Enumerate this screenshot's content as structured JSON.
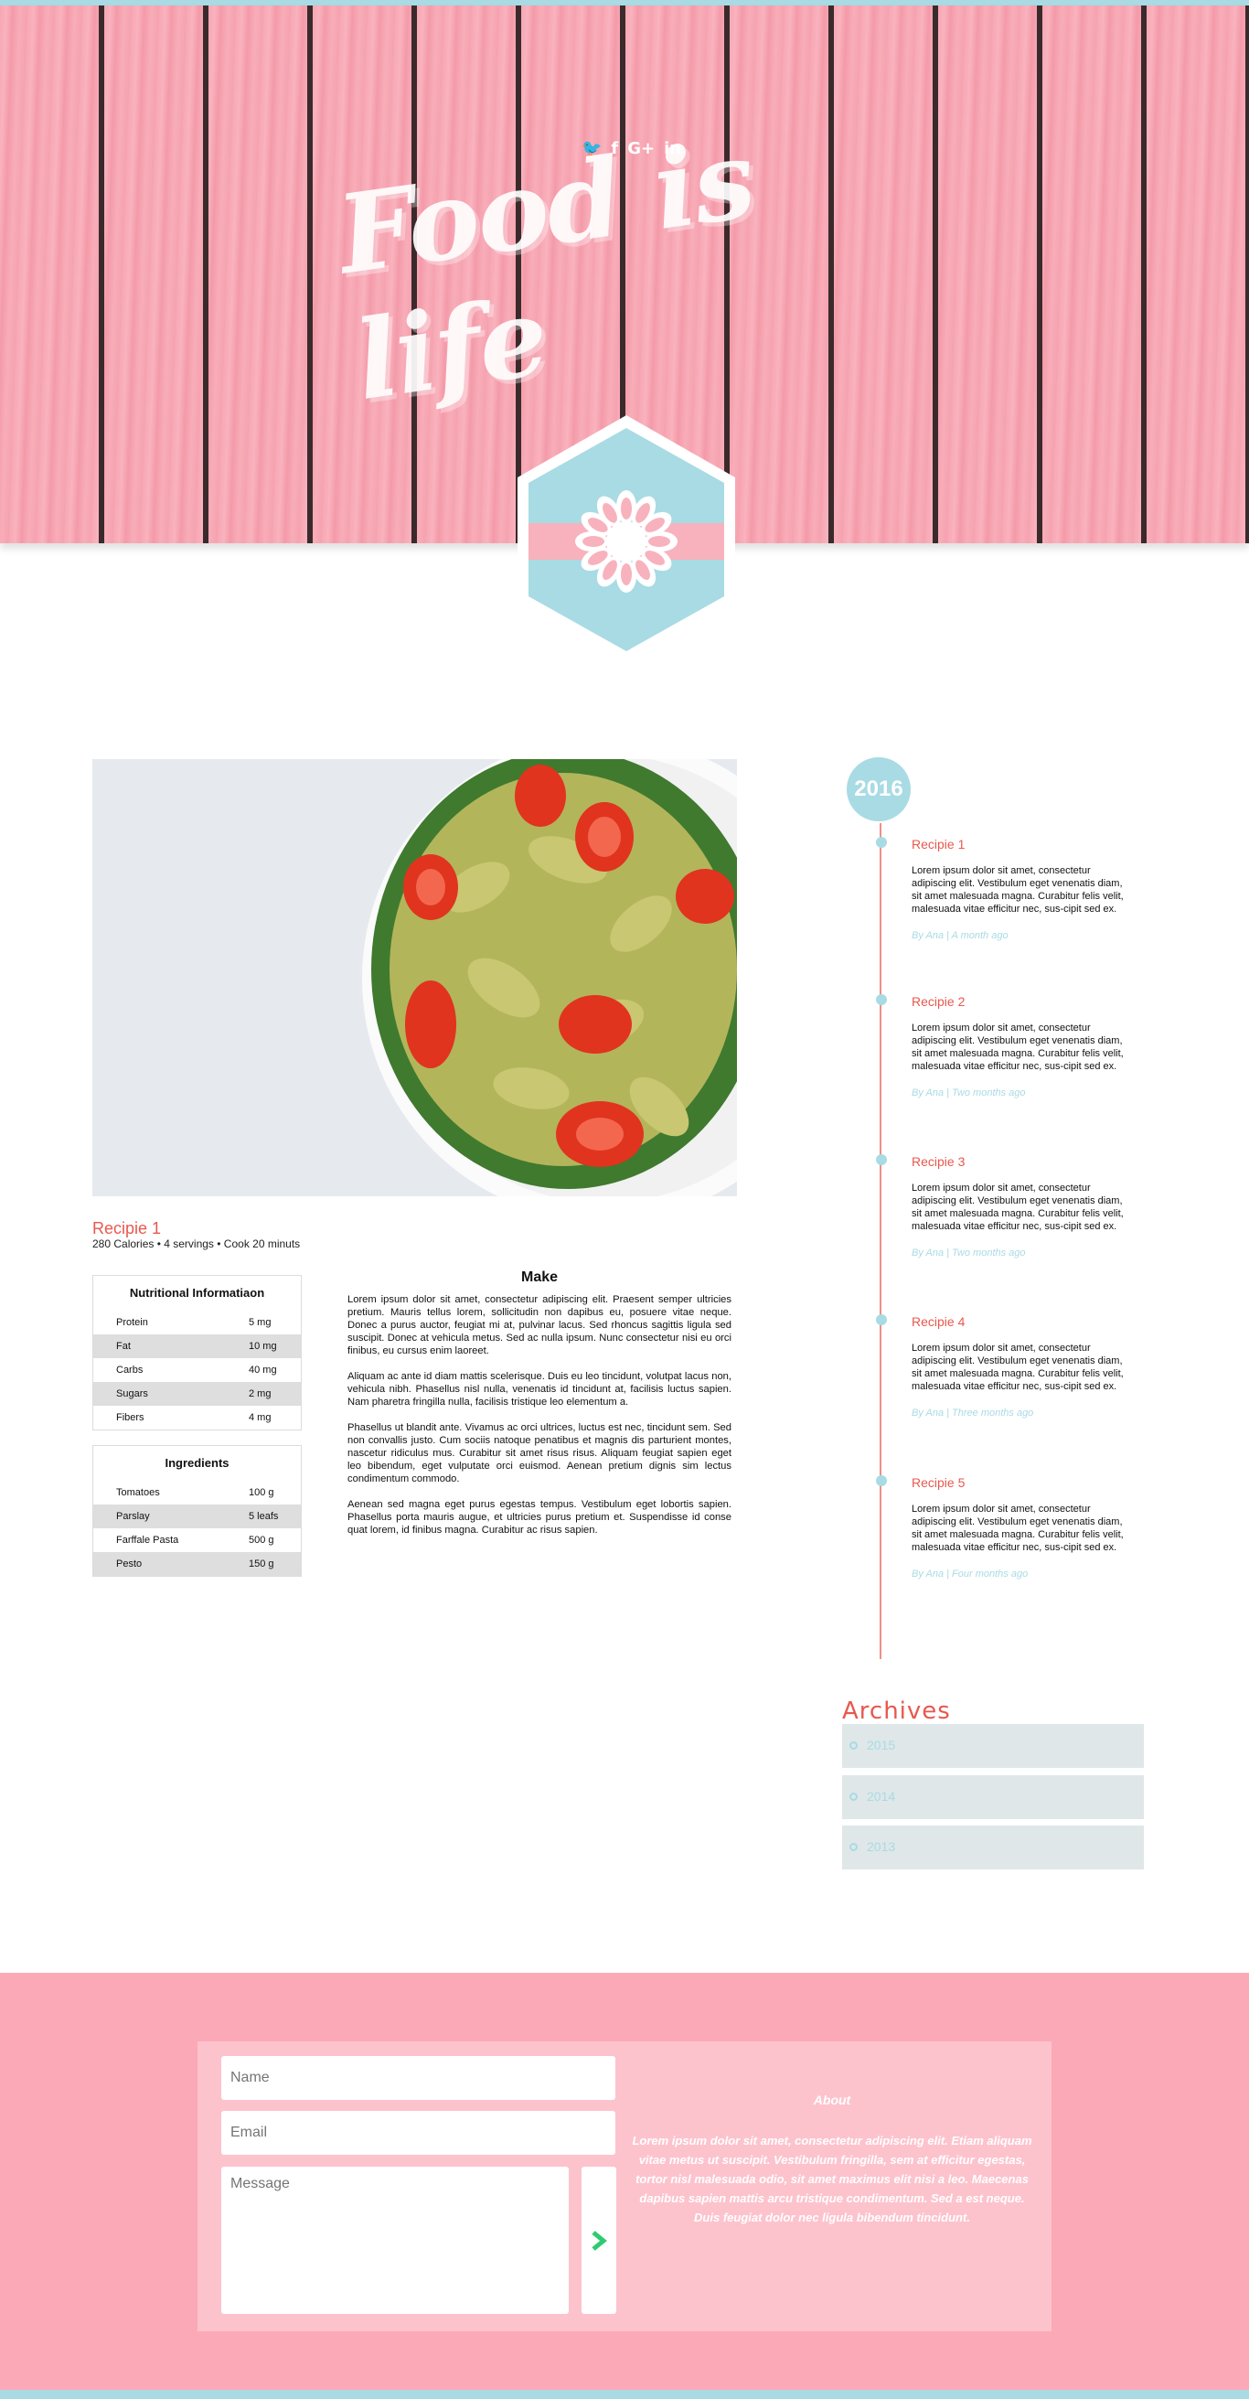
{
  "header": {
    "social_icons": [
      "twitter-icon",
      "facebook-icon",
      "google-plus-icon",
      "linkedin-icon"
    ],
    "social_glyphs": [
      "🐦",
      "f",
      "G+",
      "in"
    ],
    "logo_text": "Food is life"
  },
  "recipe": {
    "title": "Recipie 1",
    "meta": "280 Calories •  4 servings • Cook 20 minuts",
    "nutrition": {
      "caption": "Nutritional Informatiaon",
      "rows": [
        {
          "name": "Protein",
          "value": "5 mg"
        },
        {
          "name": "Fat",
          "value": "10 mg"
        },
        {
          "name": "Carbs",
          "value": "40 mg"
        },
        {
          "name": "Sugars",
          "value": "2 mg"
        },
        {
          "name": "Fibers",
          "value": "4 mg"
        }
      ]
    },
    "ingredients": {
      "caption": "Ingredients",
      "rows": [
        {
          "name": "Tomatoes",
          "value": "100 g"
        },
        {
          "name": "Parslay",
          "value": "5 leafs"
        },
        {
          "name": "Farffale Pasta",
          "value": "500 g"
        },
        {
          "name": "Pesto",
          "value": "150 g"
        }
      ]
    },
    "make": {
      "title": "Make",
      "paragraphs": [
        "Lorem ipsum dolor sit amet, consectetur adipiscing elit. Praesent semper ultricies pretium. Mauris tellus lorem, sollicitudin non dapibus eu, posuere vitae neque. Donec a purus auctor, feugiat mi at, pulvinar lacus. Sed rhoncus sagittis ligula sed suscipit. Donec at vehicula metus. Sed ac nulla ipsum. Nunc consectetur nisi eu orci finibus, eu cursus enim laoreet.",
        "Aliquam ac ante id diam mattis scelerisque. Duis eu leo tincidunt, volutpat lacus non, vehicula nibh. Phasellus nisl nulla, venenatis id tincidunt at, facilisis luctus sapien. Nam pharetra fringilla nulla, facilisis tristique leo elementum a.",
        "Phasellus ut blandit ante. Vivamus ac orci ultrices, luctus est nec, tincidunt sem. Sed non convallis justo. Cum sociis natoque penatibus et magnis dis parturient montes, nascetur ridiculus mus. Curabitur sit amet risus risus. Aliquam feugiat sapien eget leo bibendum, eget vulputate orci euismod. Aenean pretium dignis sim lectus condimentum commodo.",
        "Aenean sed magna eget purus egestas tempus. Vestibulum eget lobortis sapien. Phasellus porta mauris augue, et ultricies purus pretium et. Suspendisse id conse quat lorem, id finibus magna. Curabitur ac risus sapien."
      ]
    }
  },
  "timeline": {
    "year": "2016",
    "items": [
      {
        "title": "Recipie 1",
        "text": "Lorem ipsum dolor sit amet, consectetur adipiscing elit. Vestibulum eget venenatis diam, sit amet malesuada magna. Curabitur felis velit, malesuada vitae efficitur nec, sus-cipit sed ex.",
        "by": "By Ana | A month ago"
      },
      {
        "title": "Recipie 2",
        "text": "Lorem ipsum dolor sit amet, consectetur adipiscing elit. Vestibulum eget venenatis diam, sit amet malesuada magna. Curabitur felis velit, malesuada vitae efficitur nec, sus-cipit sed ex.",
        "by": "By Ana | Two months ago"
      },
      {
        "title": "Recipie 3",
        "text": "Lorem ipsum dolor sit amet, consectetur adipiscing elit. Vestibulum eget venenatis diam, sit amet malesuada magna. Curabitur felis velit, malesuada vitae efficitur nec, sus-cipit sed ex.",
        "by": "By Ana | Two months ago"
      },
      {
        "title": "Recipie 4",
        "text": "Lorem ipsum dolor sit amet, consectetur adipiscing elit. Vestibulum eget venenatis diam, sit amet malesuada magna. Curabitur felis velit, malesuada vitae efficitur nec, sus-cipit sed ex.",
        "by": "By Ana | Three months ago"
      },
      {
        "title": "Recipie 5",
        "text": "Lorem ipsum dolor sit amet, consectetur adipiscing elit. Vestibulum eget venenatis diam, sit amet malesuada magna. Curabitur felis velit, malesuada vitae efficitur nec, sus-cipit sed ex.",
        "by": "By Ana | Four months ago"
      }
    ]
  },
  "archives": {
    "title": "Archives",
    "items": [
      "2015",
      "2014",
      "2013"
    ]
  },
  "contact": {
    "name_placeholder": "Name",
    "email_placeholder": "Email",
    "message_placeholder": "Message",
    "about_title": "About",
    "about_text": "Lorem ipsum dolor sit amet, consectetur adipiscing elit. Etiam aliquam vitae metus ut suscipit. Vestibulum fringilla, sem at efficitur egestas, tortor nisl malesuada odio, sit amet maximus elit nisi a leo. Maecenas dapibus sapien mattis arcu tristique condimentum. Sed a est neque. Duis feugiat dolor nec ligula bibendum tincidunt."
  },
  "colors": {
    "accent_pink": "#fca9b7",
    "accent_blue": "#a8dbe4",
    "accent_red": "#e8584e",
    "send_arrow": "#2ecc71"
  }
}
